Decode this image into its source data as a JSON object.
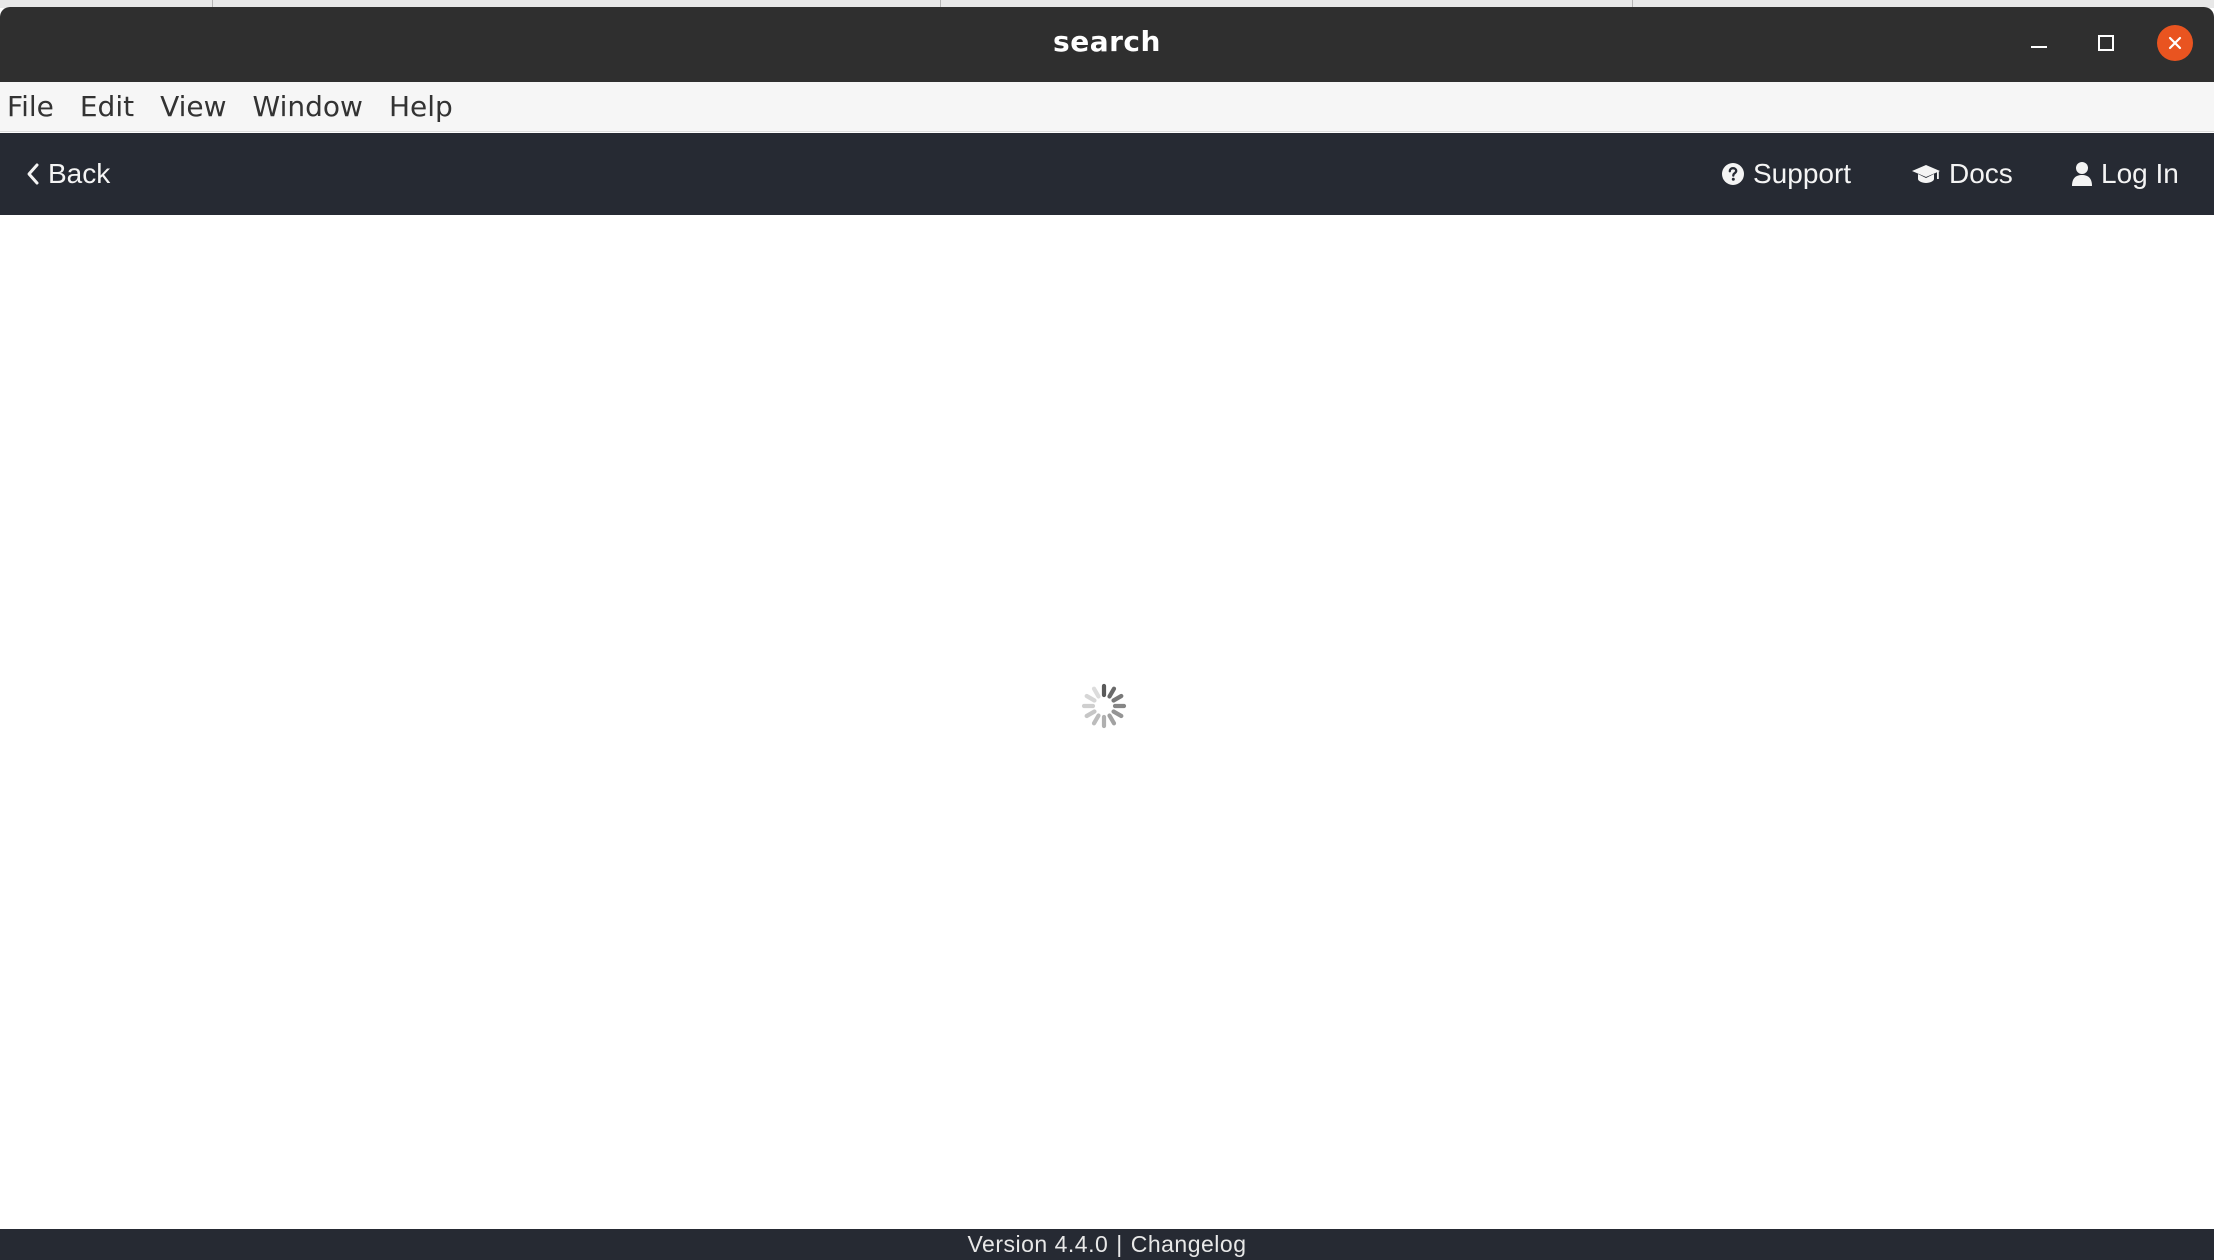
{
  "window": {
    "title": "search"
  },
  "menubar": {
    "items": [
      {
        "label": "File"
      },
      {
        "label": "Edit"
      },
      {
        "label": "View"
      },
      {
        "label": "Window"
      },
      {
        "label": "Help"
      }
    ]
  },
  "navbar": {
    "back_label": "Back",
    "support_label": "Support",
    "docs_label": "Docs",
    "login_label": "Log In",
    "icons": {
      "back": "chevron-left-icon",
      "support": "question-circle-icon",
      "docs": "graduation-cap-icon",
      "login": "user-icon"
    }
  },
  "content": {
    "state": "loading",
    "spinner_icon": "loading-spinner-icon"
  },
  "footer": {
    "version": "Version 4.4.0",
    "separator": "|",
    "changelog_label": "Changelog"
  },
  "colors": {
    "titlebar": "#2f2f2f",
    "menubar": "#f6f6f6",
    "navbar": "#262a33",
    "close_button": "#e95420",
    "spinner": "#8c8c8c"
  }
}
